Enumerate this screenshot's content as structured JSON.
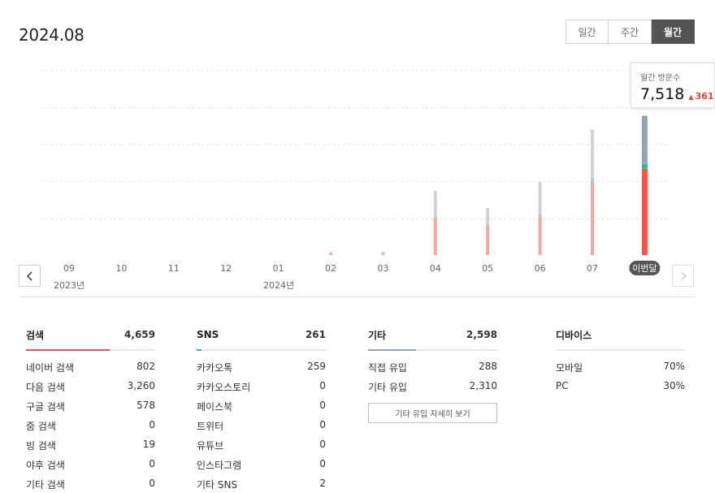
{
  "period_title": "2024.08",
  "toggle": {
    "daily": "일간",
    "weekly": "주간",
    "monthly": "월간",
    "selected": "monthly"
  },
  "tooltip": {
    "label": "월간 방문수",
    "value": "7,518",
    "delta": "361"
  },
  "colors": {
    "search": "#f1554a",
    "sns": "#1dbfa8",
    "other": "#97a3ad",
    "accent_down": "#e0453a"
  },
  "chart_data": {
    "type": "bar",
    "stacked": true,
    "categories": [
      "09",
      "10",
      "11",
      "12",
      "01",
      "02",
      "03",
      "04",
      "05",
      "06",
      "07",
      "이번달"
    ],
    "year_labels": [
      {
        "index": 0,
        "label": "2023년"
      },
      {
        "index": 4,
        "label": "2024년"
      }
    ],
    "current_index": 11,
    "series": [
      {
        "key": "search",
        "values": [
          0,
          0,
          0,
          0,
          0,
          35,
          35,
          1990,
          1590,
          2150,
          3970,
          4659
        ]
      },
      {
        "key": "sns",
        "values": [
          0,
          0,
          0,
          0,
          0,
          0,
          0,
          90,
          60,
          100,
          210,
          261
        ]
      },
      {
        "key": "other",
        "values": [
          0,
          0,
          0,
          0,
          0,
          35,
          35,
          1380,
          870,
          1680,
          2610,
          2598
        ]
      }
    ],
    "ylim": [
      0,
      10000
    ],
    "grid": true
  },
  "panels": {
    "search": {
      "name": "검색",
      "total": "4,659",
      "fill_fraction": 0.65,
      "rows": [
        {
          "label": "네이버 검색",
          "value": "802"
        },
        {
          "label": "다음 검색",
          "value": "3,260"
        },
        {
          "label": "구글 검색",
          "value": "578"
        },
        {
          "label": "줌 검색",
          "value": "0"
        },
        {
          "label": "빙 검색",
          "value": "19"
        },
        {
          "label": "야후 검색",
          "value": "0"
        },
        {
          "label": "기타 검색",
          "value": "0"
        }
      ]
    },
    "sns": {
      "name": "SNS",
      "total": "261",
      "fill_fraction": 0.04,
      "rows": [
        {
          "label": "카카오톡",
          "value": "259"
        },
        {
          "label": "카카오스토리",
          "value": "0"
        },
        {
          "label": "페이스북",
          "value": "0"
        },
        {
          "label": "트위터",
          "value": "0"
        },
        {
          "label": "유튜브",
          "value": "0"
        },
        {
          "label": "인스타그램",
          "value": "0"
        },
        {
          "label": "기타 SNS",
          "value": "2"
        }
      ]
    },
    "other": {
      "name": "기타",
      "total": "2,598",
      "fill_fraction": 0.37,
      "rows": [
        {
          "label": "직접 유입",
          "value": "288"
        },
        {
          "label": "기타 유입",
          "value": "2,310"
        }
      ],
      "detail_button": "기타 유입 자세히 보기"
    },
    "device": {
      "name": "디바이스",
      "rows": [
        {
          "label": "모바일",
          "value": "70%"
        },
        {
          "label": "PC",
          "value": "30%"
        }
      ]
    }
  }
}
